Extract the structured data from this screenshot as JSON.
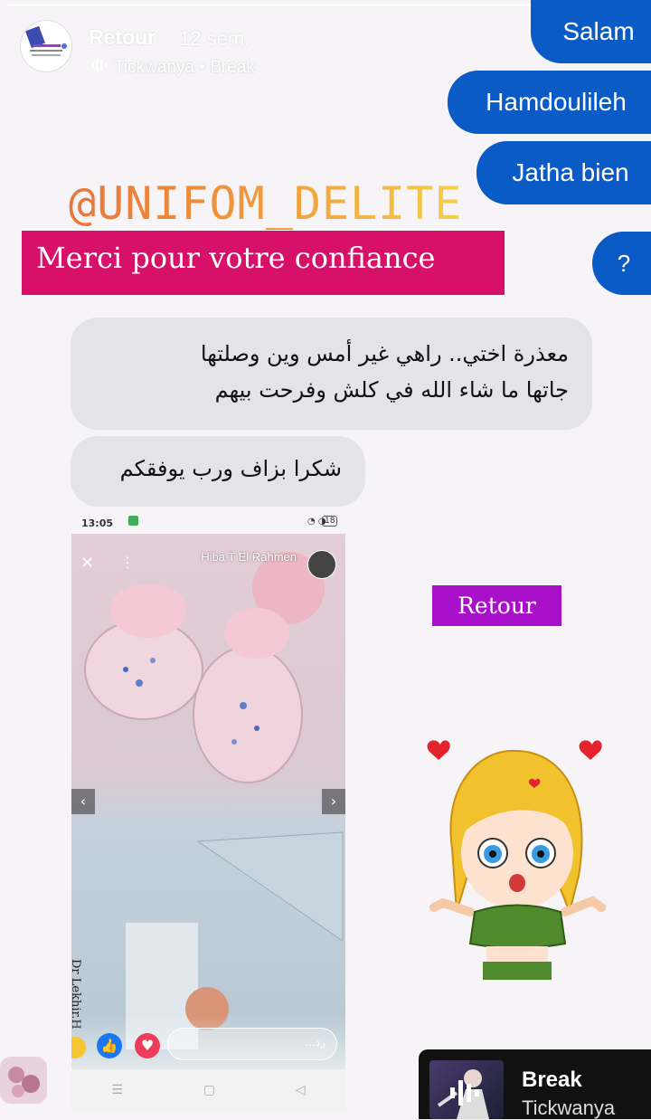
{
  "header": {
    "username": "Retour",
    "age": "12 sem.",
    "music_line": "Tickwanya • Break",
    "progress_fraction": 1.0
  },
  "chat": {
    "outgoing": [
      "Salam",
      "Hamdoulileh",
      "Jatha bien",
      "?"
    ],
    "incoming": [
      [
        "معذرة اختي.. راهي غير أمس وين وصلتها",
        "جاتها ما شاء الله في كلش وفرحت بيهم"
      ],
      [
        "شكرا بزاف ورب يوفقكم"
      ]
    ]
  },
  "stickers": {
    "brand": "@UNIFOM_DELITE",
    "thanks": "Merci pour votre confiance",
    "retour_tag": "Retour"
  },
  "screenshot": {
    "time": "13:05",
    "battery": "18",
    "poster_name": "Hiba T El Rahmen",
    "reply_placeholder": "رد...",
    "handwriting": "Dr Lekhir.H"
  },
  "music_card": {
    "title": "Break",
    "artist": "Tickwanya"
  },
  "colors": {
    "bubble_blue": "#0b5bc7",
    "thanks_bg": "#d7116a",
    "retour_bg": "#a810c9",
    "bubble_grey": "#e4e3e7"
  }
}
